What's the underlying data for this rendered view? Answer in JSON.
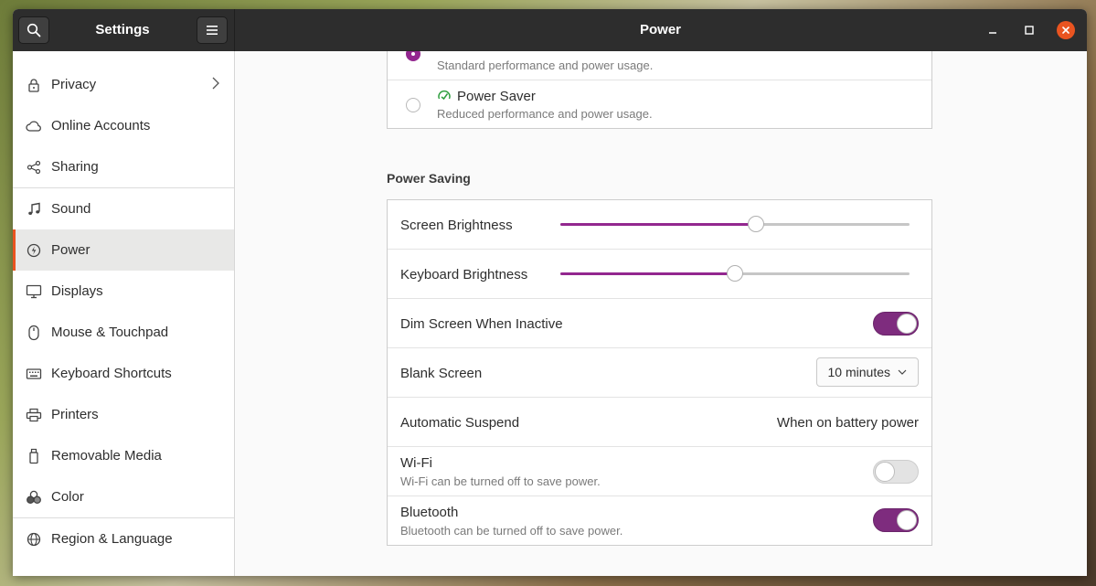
{
  "window": {
    "sidebar_title": "Settings",
    "title": "Power"
  },
  "sidebar": {
    "items": [
      {
        "label": "Privacy",
        "icon": "lock-icon"
      },
      {
        "label": "Online Accounts",
        "icon": "cloud-icon"
      },
      {
        "label": "Sharing",
        "icon": "share-icon"
      },
      {
        "label": "Sound",
        "icon": "music-note-icon"
      },
      {
        "label": "Power",
        "icon": "power-icon"
      },
      {
        "label": "Displays",
        "icon": "display-icon"
      },
      {
        "label": "Mouse & Touchpad",
        "icon": "mouse-icon"
      },
      {
        "label": "Keyboard Shortcuts",
        "icon": "keyboard-icon"
      },
      {
        "label": "Printers",
        "icon": "printer-icon"
      },
      {
        "label": "Removable Media",
        "icon": "usb-drive-icon"
      },
      {
        "label": "Color",
        "icon": "color-icon"
      },
      {
        "label": "Region & Language",
        "icon": "globe-icon"
      }
    ],
    "active": "Power"
  },
  "power_mode": {
    "balanced": {
      "description": "Standard performance and power usage."
    },
    "saver": {
      "title": "Power Saver",
      "description": "Reduced performance and power usage."
    }
  },
  "power_saving": {
    "title": "Power Saving",
    "screen_brightness": {
      "label": "Screen Brightness",
      "value_percent": 56
    },
    "keyboard_brightness": {
      "label": "Keyboard Brightness",
      "value_percent": 50
    },
    "dim_screen": {
      "label": "Dim Screen When Inactive",
      "enabled": true
    },
    "blank_screen": {
      "label": "Blank Screen",
      "value": "10 minutes"
    },
    "automatic_suspend": {
      "label": "Automatic Suspend",
      "value": "When on battery power"
    },
    "wifi": {
      "label": "Wi-Fi",
      "description": "Wi-Fi can be turned off to save power.",
      "enabled": false
    },
    "bluetooth": {
      "label": "Bluetooth",
      "description": "Bluetooth can be turned off to save power.",
      "enabled": true
    }
  },
  "colors": {
    "accent": "#93278f",
    "selection_bar": "#e95420",
    "titlebar": "#2d2d2d"
  }
}
